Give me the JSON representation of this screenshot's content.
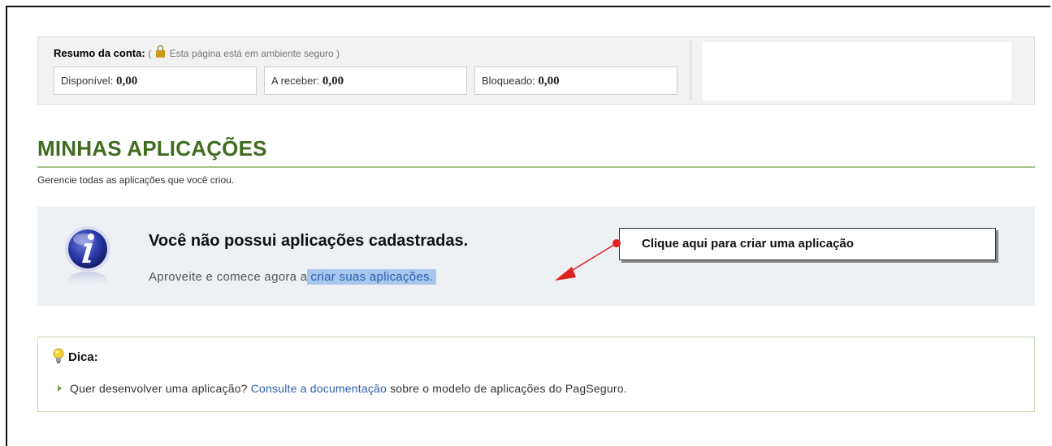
{
  "summary": {
    "title": "Resumo da conta:",
    "secure_open": "(",
    "secure_text": "Esta página está em ambiente seguro )",
    "available_label": "Disponível:",
    "available_value": "0,00",
    "receivable_label": "A receber:",
    "receivable_value": "0,00",
    "blocked_label": "Bloqueado:",
    "blocked_value": "0,00"
  },
  "page": {
    "title": "MINHAS APLICAÇÕES",
    "subtitle": "Gerencie todas as aplicações que você criou."
  },
  "info": {
    "title": "Você não possui aplicações cadastradas.",
    "body_prefix": "Aproveite e comece agora a",
    "link_text": "criar suas aplicações."
  },
  "callout": {
    "text": "Clique aqui para criar uma aplicação"
  },
  "tip": {
    "title": "Dica:",
    "text_prefix": "Quer desenvolver uma aplicação?",
    "link_text": "Consulte a documentação",
    "text_suffix": "sobre o modelo de aplicações do PagSeguro."
  },
  "icons": {
    "lock": "lock-icon",
    "info": "info-icon",
    "tip": "lightbulb-icon",
    "bullet": "triangle-bullet-icon"
  },
  "colors": {
    "title_green": "#3f6c1f",
    "link_blue": "#2c5fb0",
    "link_highlight": "#a8c6ee",
    "arrow_red": "#e02020",
    "info_bg": "#eef1f4"
  }
}
